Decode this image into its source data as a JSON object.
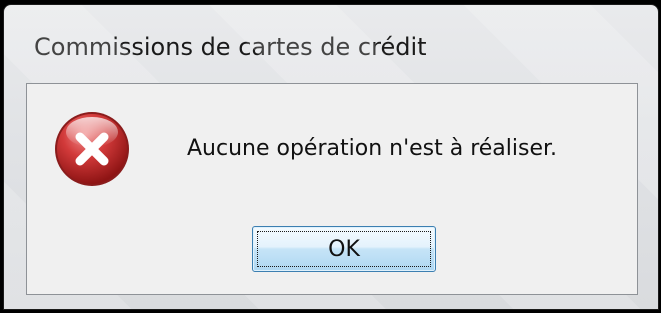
{
  "window": {
    "title": "Commissions de cartes de crédit"
  },
  "dialog": {
    "icon": "error-icon",
    "message": "Aucune opération n'est à réaliser.",
    "ok_label": "OK"
  },
  "colors": {
    "error_red": "#c62a2a",
    "button_border": "#3c7fb1"
  }
}
